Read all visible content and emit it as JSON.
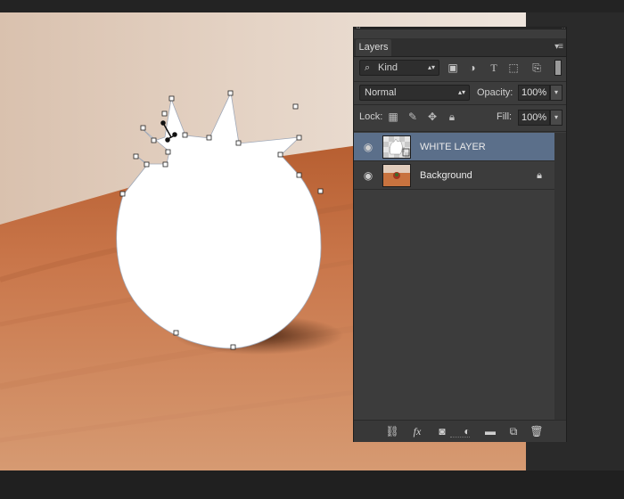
{
  "panel": {
    "title": "Layers",
    "filter": {
      "kind_label": "Kind"
    },
    "blend_mode": "Normal",
    "opacity_label": "Opacity:",
    "opacity_value": "100%",
    "lock_label": "Lock:",
    "fill_label": "Fill:",
    "fill_value": "100%",
    "layers": [
      {
        "name": "WHITE LAYER",
        "selected": true,
        "visible": true
      },
      {
        "name": "Background",
        "selected": false,
        "visible": true,
        "locked": true
      }
    ]
  },
  "colors": {
    "selected_row": "#5b6f8a",
    "panel_bg": "#3c3c3c",
    "shape_fill": "#ffffff"
  }
}
